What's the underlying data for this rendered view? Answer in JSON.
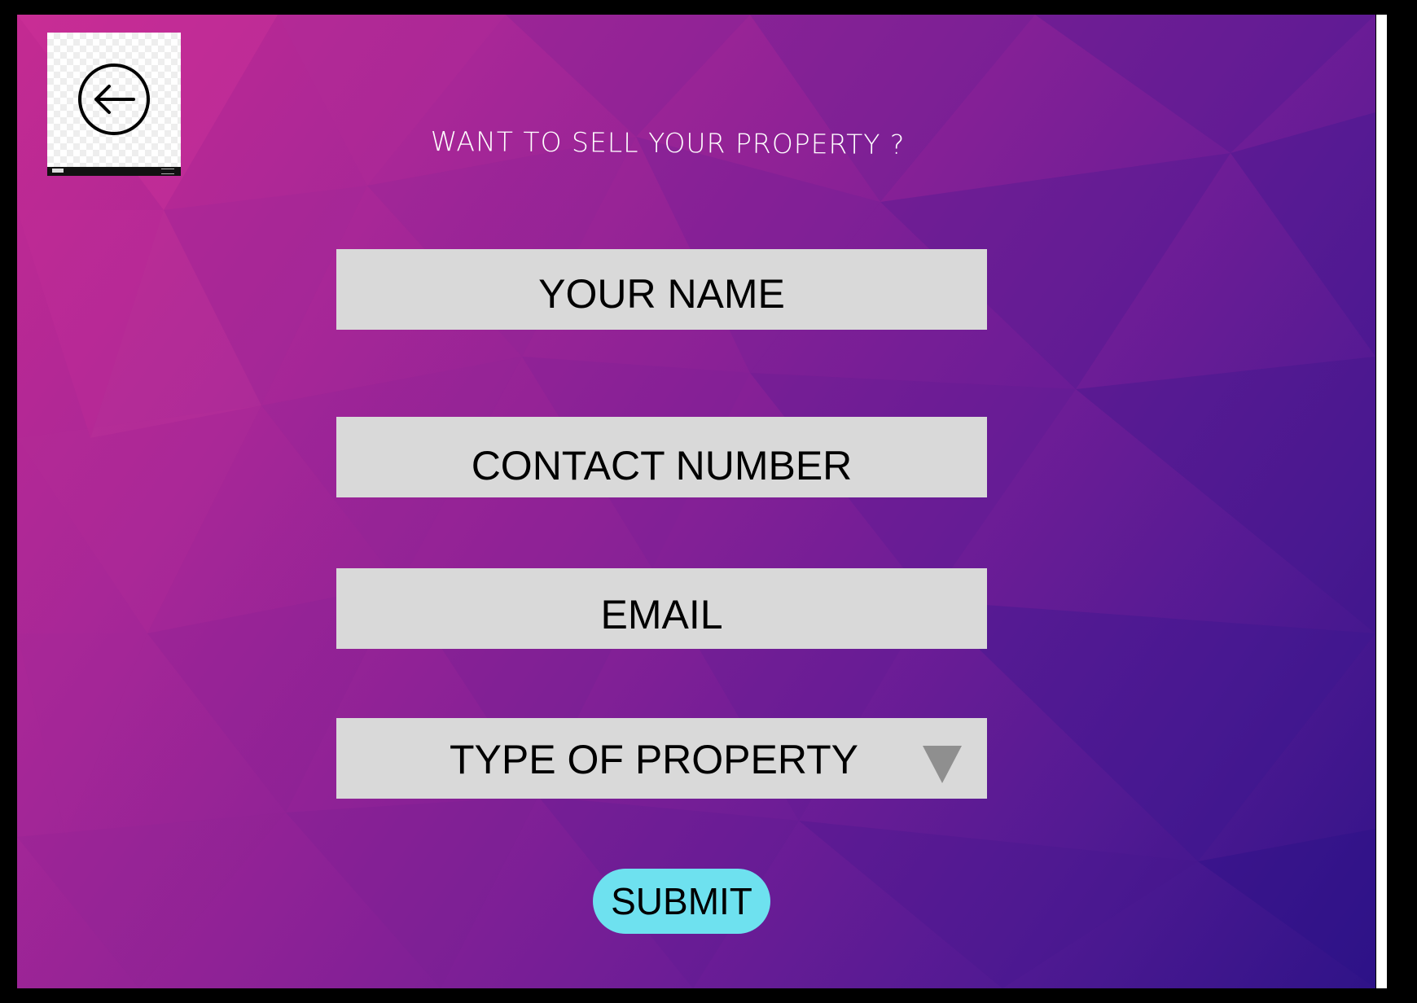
{
  "colors": {
    "frame": "#000000",
    "background_gradient": [
      "#c42a92",
      "#8a2196",
      "#531a93",
      "#2f1388"
    ],
    "field_background": "#d9d9d9",
    "field_text": "#000000",
    "heading_text": "#ffffff",
    "submit_background": "#6ee1ef",
    "dropdown_arrow": "#8f8f8f"
  },
  "back_button": {
    "icon": "arrow-left-circle-icon"
  },
  "form": {
    "heading": "WANT TO SELL YOUR PROPERTY ?",
    "name_placeholder": "YOUR NAME",
    "contact_placeholder": "CONTACT NUMBER",
    "email_placeholder": "EMAIL",
    "property_type": {
      "selected_label": "TYPE OF PROPERTY",
      "icon": "triangle-down-icon"
    },
    "submit_label": "SUBMIT"
  }
}
